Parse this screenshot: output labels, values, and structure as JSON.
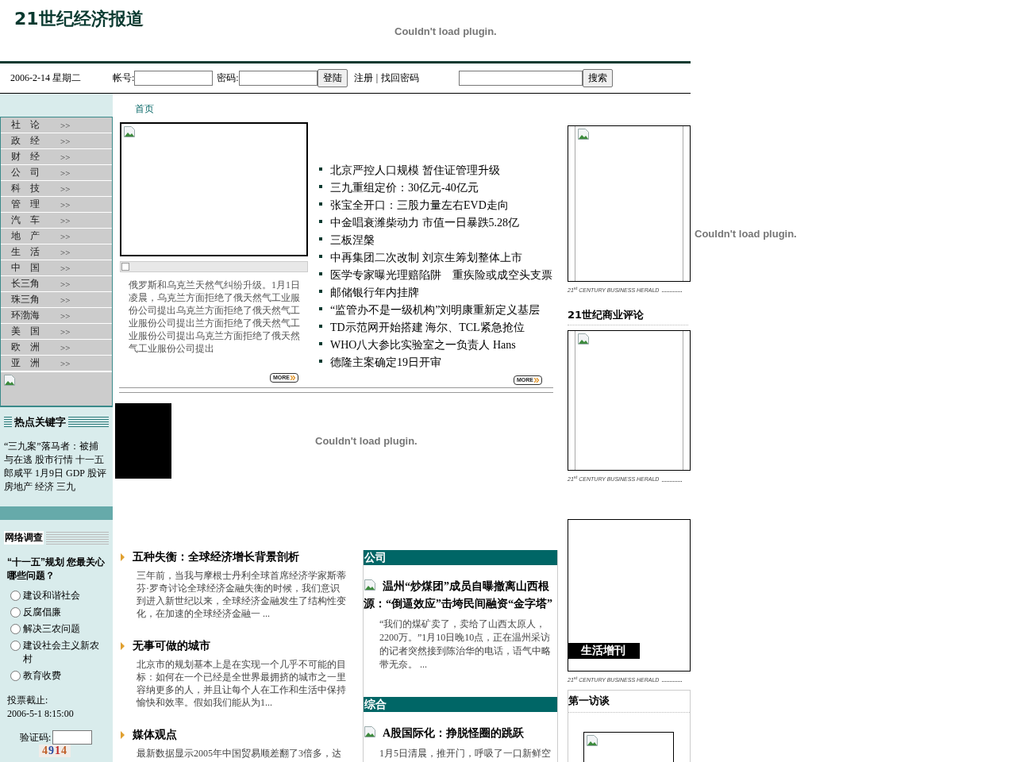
{
  "header": {
    "logo": "21世纪经济报道",
    "plugin_message": "Couldn't load plugin."
  },
  "login_bar": {
    "date": "2006-2-14 星期二",
    "account_label": "帐号:",
    "password_label": "密码:",
    "login_button": "登陆",
    "register_link": "注册",
    "separator": "|",
    "recover_link": "找回密码",
    "search_button": "搜索"
  },
  "breadcrumb": "首页",
  "nav": [
    {
      "label": "社　论",
      "arrow": ">>"
    },
    {
      "label": "政　经",
      "arrow": ">>"
    },
    {
      "label": "财　经",
      "arrow": ">>"
    },
    {
      "label": "公　司",
      "arrow": ">>"
    },
    {
      "label": "科　技",
      "arrow": ">>"
    },
    {
      "label": "管　理",
      "arrow": ">>"
    },
    {
      "label": "汽　车",
      "arrow": ">>"
    },
    {
      "label": "地　产",
      "arrow": ">>"
    },
    {
      "label": "生　活",
      "arrow": ">>"
    },
    {
      "label": "中　国",
      "arrow": ">>"
    },
    {
      "label": "长三角",
      "arrow": ">>"
    },
    {
      "label": "珠三角",
      "arrow": ">>"
    },
    {
      "label": "环渤海",
      "arrow": ">>"
    },
    {
      "label": "美　国",
      "arrow": ">>"
    },
    {
      "label": "欧　洲",
      "arrow": ">>"
    },
    {
      "label": "亚　洲",
      "arrow": ">>"
    }
  ],
  "keywords": {
    "title": "热点关键字",
    "lines": [
      "“三九案”落马者：被捕",
      "与在逃 股市行情 十一五",
      "郎咸平 1月9日 GDP 股评",
      "房地产 经济 三九"
    ]
  },
  "poll": {
    "title": "网络调查",
    "question": "“十一五”规划 您最关心哪些问题？",
    "options": [
      {
        "label": "建设和谐社会",
        "selected": false
      },
      {
        "label": "反腐倡廉",
        "selected": false
      },
      {
        "label": "解决三农问题",
        "selected": false
      },
      {
        "label": "建设社会主义新农村",
        "selected": false
      },
      {
        "label": "教育收费",
        "selected": false
      }
    ],
    "deadline_label": "投票截止:",
    "deadline": "2006-5-1 8:15:00",
    "captcha_label": "验证码:",
    "captcha_digits": [
      {
        "digit": "4",
        "color": "#c0602a"
      },
      {
        "digit": "9",
        "color": "#2a4aa0"
      },
      {
        "digit": "1",
        "color": "#c02a2a"
      },
      {
        "digit": "4",
        "color": "#c0602a"
      }
    ]
  },
  "feature": {
    "caption": "俄罗斯和乌克兰天然气纠纷升级。1月1日凌晨，乌克兰方面拒绝了俄天然气工业服份公司提出乌克兰方面拒绝了俄天然气工业服份公司提出兰方面拒绝了俄天然气工业服份公司提出乌克兰方面拒绝了俄天然气工业服份公司提出",
    "more": "MORE"
  },
  "headlines": [
    "北京严控人口规模 暂住证管理升级",
    "三九重组定价：30亿元-40亿元",
    "张宝全开口：三股力量左右EVD走向",
    "中金唱衰潍柴动力 市值一日暴跌5.28亿",
    "三板涅槃",
    "中再集团二次改制 刘京生筹划整体上市",
    "医学专家曝光理赔陷阱　重疾险或成空头支票",
    "邮储银行年内挂牌",
    "“监管办不是一级机构”刘明康重新定义基层",
    "TD示范网开始搭建 海尔、TCL紧急抢位",
    "WHO八大参比实验室之一负责人 Hans",
    "德隆主案确定19日开审"
  ],
  "headlines_more": "MORE",
  "center_plugin_message": "Couldn't load plugin.",
  "articles": [
    {
      "title": "五种失衡：全球经济增长背景剖析",
      "summary": "三年前，当我与摩根士丹利全球首席经济学家斯蒂芬·罗奇讨论全球经济金融失衡的时候，我们意识到进入新世纪以来，全球经济金融发生了结构性变化，在加速的全球经济金融一 ..."
    },
    {
      "title": "无事可做的城市",
      "summary": "北京市的规划基本上是在实现一个几乎不可能的目标：如何在一个已经是全世界最拥挤的城市之一里容纳更多的人，并且让每个人在工作和生活中保持愉快和效率。假如我们能从为1..."
    },
    {
      "title": "媒体观点",
      "summary": "最新数据显示2005年中国贸易顺差翻了3倍多，达"
    }
  ],
  "sections": [
    {
      "title": "公司",
      "article_title": "温州“炒煤团”成员自曝撤离山西根源：“倒逼效应”击垮民间融资“金字塔”",
      "summary": "“我们的煤矿卖了，卖给了山西太原人，2200万。”1月10日晚10点，正在温州采访的记者突然接到陈治华的电话，语气中略带无奈。 ..."
    },
    {
      "title": "综合",
      "article_title": "A股国际化：挣脱怪圈的跳跃",
      "summary": "1月5日清晨，推开门，呼吸了一口新鲜空"
    }
  ],
  "right_column": [
    {
      "kind": "cover",
      "herald": "21$^{st}$ CENTURY BUSINESS HERALD"
    },
    {
      "kind": "heading",
      "title": "21世纪商业评论"
    },
    {
      "kind": "cover",
      "herald": "21$^{st}$ CENTURY BUSINESS HERALD"
    },
    {
      "kind": "labeled_cover",
      "label": "生活增刊",
      "herald": "21$^{st}$ CENTURY BUSINESS HERALD"
    },
    {
      "kind": "interview",
      "title": "第一访谈"
    }
  ],
  "right_plugin_message": "Couldn't load plugin."
}
